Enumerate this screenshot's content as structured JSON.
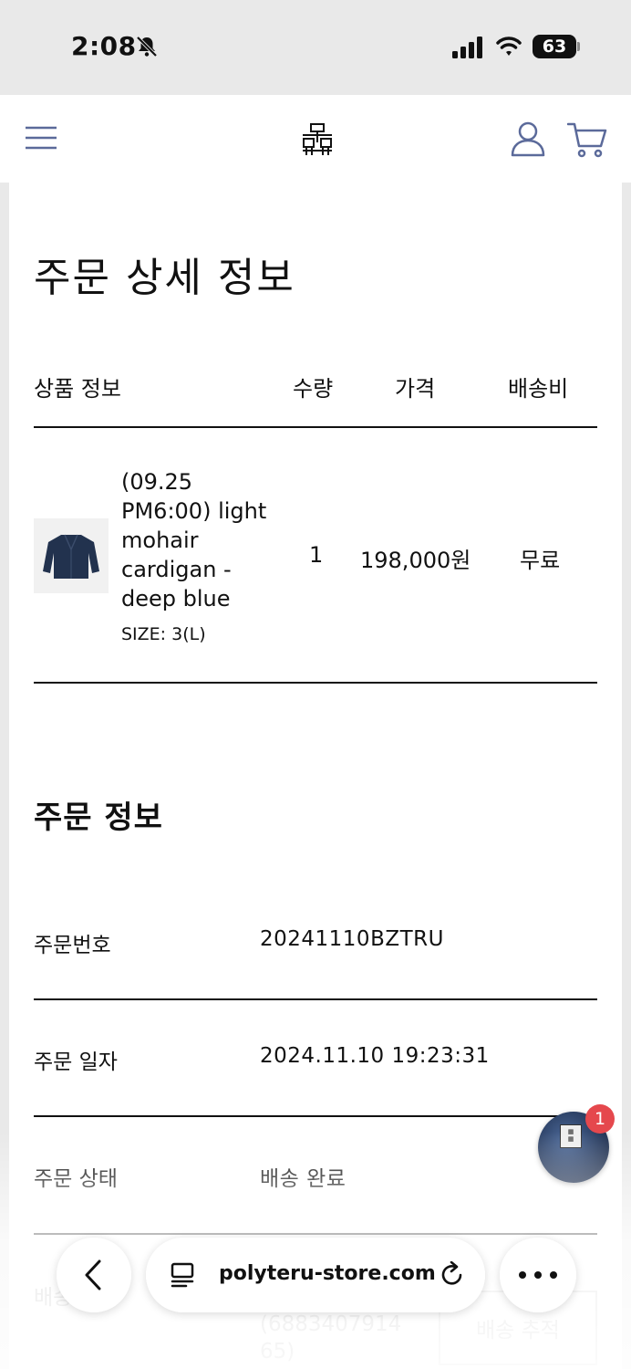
{
  "status_bar": {
    "time": "2:08",
    "battery": "63"
  },
  "header": {
    "menu": "menu-icon",
    "logo": "logo-icon",
    "account": "user-icon",
    "cart": "cart-icon"
  },
  "page": {
    "title": "주문 상세 정보",
    "table_headers": {
      "product": "상품 정보",
      "quantity": "수량",
      "price": "가격",
      "shipping": "배송비"
    },
    "product": {
      "name": "(09.25 PM6:00) light mohair cardigan - deep blue",
      "size": "SIZE: 3(L)",
      "quantity": "1",
      "price": "198,000원",
      "shipping": "무료"
    },
    "order_info": {
      "title": "주문 정보",
      "rows": [
        {
          "label": "주문번호",
          "value": "20241110BZTRU"
        },
        {
          "label": "주문 일자",
          "value": "2024.11.10 19:23:31"
        },
        {
          "label": "주문 상태",
          "value": "배송 완료"
        },
        {
          "label": "배송",
          "value": "(6883407914 65)"
        }
      ],
      "track_button": "배송 추적"
    }
  },
  "chat": {
    "badge": "1"
  },
  "browser": {
    "url": "polyteru-store.com"
  }
}
